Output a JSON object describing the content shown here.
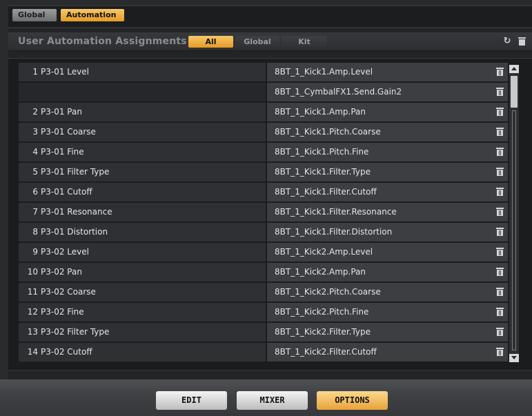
{
  "top_tabs": {
    "global": "Global",
    "automation": "Automation"
  },
  "header": {
    "title": "User Automation Assignments",
    "filters": {
      "all": "All",
      "global": "Global",
      "kit": "Kit"
    },
    "refresh_icon": "refresh-icon",
    "delete_icon": "trash-icon"
  },
  "rows": [
    {
      "num": "1",
      "name": "P3-01 Level",
      "param": "8BT_1_Kick1.Amp.Level"
    },
    {
      "num": "",
      "name": "",
      "param": "8BT_1_CymbalFX1.Send.Gain2"
    },
    {
      "num": "2",
      "name": "P3-01 Pan",
      "param": "8BT_1_Kick1.Amp.Pan"
    },
    {
      "num": "3",
      "name": "P3-01 Coarse",
      "param": "8BT_1_Kick1.Pitch.Coarse"
    },
    {
      "num": "4",
      "name": "P3-01 Fine",
      "param": "8BT_1_Kick1.Pitch.Fine"
    },
    {
      "num": "5",
      "name": "P3-01 Filter Type",
      "param": "8BT_1_Kick1.Filter.Type"
    },
    {
      "num": "6",
      "name": "P3-01 Cutoff",
      "param": "8BT_1_Kick1.Filter.Cutoff"
    },
    {
      "num": "7",
      "name": "P3-01 Resonance",
      "param": "8BT_1_Kick1.Filter.Resonance"
    },
    {
      "num": "8",
      "name": "P3-01 Distortion",
      "param": "8BT_1_Kick1.Filter.Distortion"
    },
    {
      "num": "9",
      "name": "P3-02 Level",
      "param": "8BT_1_Kick2.Amp.Level"
    },
    {
      "num": "10",
      "name": "P3-02 Pan",
      "param": "8BT_1_Kick2.Amp.Pan"
    },
    {
      "num": "11",
      "name": "P3-02 Coarse",
      "param": "8BT_1_Kick2.Pitch.Coarse"
    },
    {
      "num": "12",
      "name": "P3-02 Fine",
      "param": "8BT_1_Kick2.Pitch.Fine"
    },
    {
      "num": "13",
      "name": "P3-02 Filter Type",
      "param": "8BT_1_Kick2.Filter.Type"
    },
    {
      "num": "14",
      "name": "P3-02 Cutoff",
      "param": "8BT_1_Kick2.Filter.Cutoff"
    }
  ],
  "bottom": {
    "edit": "EDIT",
    "mixer": "MIXER",
    "options": "OPTIONS"
  },
  "colors": {
    "accent": "#e9a23a",
    "background": "#2a2b2d"
  }
}
